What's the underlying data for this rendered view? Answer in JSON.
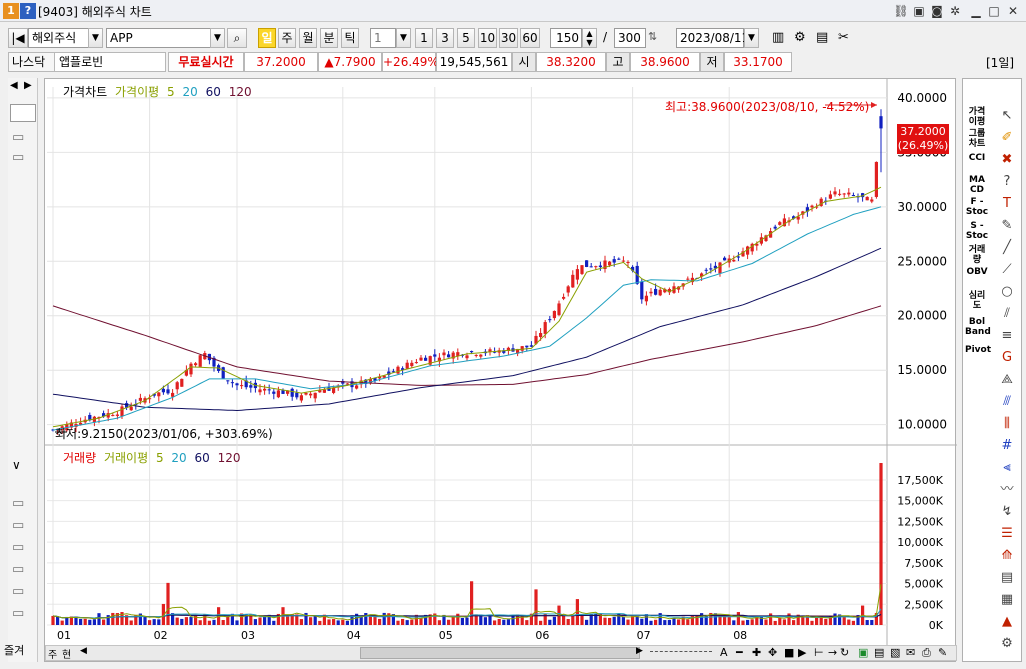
{
  "title": {
    "badge1": "1",
    "badge2": "?",
    "text": "[9403] 해외주식 차트"
  },
  "toolbar": {
    "market": "해외주식",
    "symbol": "APP",
    "periods": [
      "일",
      "주",
      "월",
      "분",
      "틱"
    ],
    "interval": "1",
    "minutes": [
      "1",
      "3",
      "5",
      "10",
      "30",
      "60"
    ],
    "count": "150",
    "slash": "/",
    "total": "300",
    "date": "2023/08/11"
  },
  "info": {
    "exchange": "나스닥",
    "name": "앱플로빈",
    "realtime": "무료실시간",
    "price": "37.2000",
    "change": "▲7.7900",
    "pct": "+26.49%",
    "volume": "19,545,561",
    "open_lbl": "시",
    "open": "38.3200",
    "high_lbl": "고",
    "high": "38.9600",
    "low_lbl": "저",
    "low": "33.1700",
    "period_tag": "[1일]"
  },
  "price_legend": {
    "name": "가격차트",
    "ma_name": "가격이평",
    "m5": "5",
    "m20": "20",
    "m60": "60",
    "m120": "120"
  },
  "volume_legend": {
    "name": "거래량",
    "ma_name": "거래이평",
    "m5": "5",
    "m20": "20",
    "m60": "60",
    "m120": "120"
  },
  "annotations": {
    "high": "최고:38.9600(2023/08/10, -4.52%)",
    "low": "최저:9.2150(2023/01/06, +303.69%)",
    "cur_price": "37.2000",
    "cur_pct": "(26.49%)"
  },
  "right_tools": [
    "가격 이평",
    "그룹 차트",
    "CCI",
    "MA CD",
    "F - Stoc",
    "S - Stoc",
    "거래 량",
    "OBV",
    "심리 도",
    "Bol Band",
    "Pivot"
  ],
  "bottom": {
    "tab1": "즐겨",
    "tab2": "주",
    "tab3": "현",
    "zoom_label": "A"
  },
  "colors": {
    "up": "#e02020",
    "down": "#1020c0",
    "ma5": "#8aa000",
    "ma20": "#20a0c0",
    "ma60": "#101060",
    "ma120": "#701030"
  },
  "chart_data": {
    "type": "candlestick",
    "months": [
      "01",
      "02",
      "03",
      "04",
      "05",
      "06",
      "07",
      "08"
    ],
    "price_axis": [
      "40.0000",
      "35.0000",
      "30.0000",
      "25.0000",
      "20.0000",
      "15.0000",
      "10.0000"
    ],
    "price_ylim": [
      8.5,
      41.0
    ],
    "volume_axis": [
      "17,500K",
      "15,000K",
      "12,500K",
      "10,000K",
      "7,500K",
      "5,000K",
      "2,500K",
      "0K"
    ],
    "volume_ylim": [
      0,
      19545561
    ],
    "close_path": [
      [
        0,
        9.5
      ],
      [
        6,
        10.4
      ],
      [
        14,
        11.2
      ],
      [
        22,
        12.8
      ],
      [
        26,
        13.2
      ],
      [
        30,
        15.6
      ],
      [
        33,
        16.5
      ],
      [
        36,
        14.8
      ],
      [
        40,
        13.6
      ],
      [
        46,
        13.2
      ],
      [
        50,
        13.0
      ],
      [
        54,
        12.5
      ],
      [
        58,
        13.2
      ],
      [
        64,
        13.6
      ],
      [
        70,
        14.0
      ],
      [
        76,
        15.3
      ],
      [
        80,
        16.1
      ],
      [
        88,
        16.6
      ],
      [
        96,
        16.7
      ],
      [
        104,
        17.2
      ],
      [
        110,
        21.2
      ],
      [
        114,
        24.5
      ],
      [
        120,
        24.8
      ],
      [
        125,
        25.0
      ],
      [
        128,
        21.6
      ],
      [
        132,
        22.4
      ],
      [
        138,
        23.2
      ],
      [
        146,
        24.8
      ],
      [
        152,
        26.5
      ],
      [
        158,
        28.5
      ],
      [
        162,
        29.1
      ],
      [
        166,
        30.3
      ],
      [
        170,
        31.2
      ],
      [
        174,
        31.0
      ],
      [
        178,
        30.5
      ],
      [
        180,
        37.2
      ]
    ],
    "ma5_path": [
      [
        0,
        9.8
      ],
      [
        10,
        10.6
      ],
      [
        20,
        12.2
      ],
      [
        30,
        15.3
      ],
      [
        36,
        15.2
      ],
      [
        44,
        13.6
      ],
      [
        54,
        12.9
      ],
      [
        64,
        13.6
      ],
      [
        76,
        15.0
      ],
      [
        90,
        16.5
      ],
      [
        104,
        17.0
      ],
      [
        110,
        19.5
      ],
      [
        116,
        24.0
      ],
      [
        124,
        24.9
      ],
      [
        128,
        23.4
      ],
      [
        134,
        22.2
      ],
      [
        142,
        23.8
      ],
      [
        150,
        25.8
      ],
      [
        160,
        28.7
      ],
      [
        168,
        30.5
      ],
      [
        176,
        31.0
      ],
      [
        180,
        31.8
      ]
    ],
    "ma20_path": [
      [
        0,
        9.5
      ],
      [
        14,
        10.6
      ],
      [
        26,
        12.5
      ],
      [
        34,
        14.2
      ],
      [
        44,
        14.2
      ],
      [
        56,
        13.3
      ],
      [
        68,
        13.8
      ],
      [
        82,
        15.4
      ],
      [
        98,
        16.3
      ],
      [
        108,
        17.2
      ],
      [
        116,
        19.8
      ],
      [
        124,
        22.8
      ],
      [
        130,
        23.3
      ],
      [
        140,
        23.2
      ],
      [
        152,
        24.8
      ],
      [
        164,
        27.5
      ],
      [
        174,
        29.3
      ],
      [
        180,
        30.0
      ]
    ],
    "ma60_path": [
      [
        0,
        12.8
      ],
      [
        20,
        11.6
      ],
      [
        40,
        11.3
      ],
      [
        60,
        11.9
      ],
      [
        80,
        13.4
      ],
      [
        100,
        14.5
      ],
      [
        116,
        16.2
      ],
      [
        132,
        19.0
      ],
      [
        150,
        21.0
      ],
      [
        166,
        23.6
      ],
      [
        180,
        26.2
      ]
    ],
    "ma120_path": [
      [
        0,
        20.9
      ],
      [
        20,
        18.2
      ],
      [
        40,
        15.3
      ],
      [
        60,
        14.0
      ],
      [
        80,
        13.6
      ],
      [
        100,
        13.7
      ],
      [
        116,
        14.6
      ],
      [
        130,
        16.0
      ],
      [
        150,
        17.6
      ],
      [
        166,
        19.1
      ],
      [
        180,
        20.9
      ]
    ],
    "vol_spikes": [
      [
        15,
        0.08
      ],
      [
        24,
        0.13
      ],
      [
        25,
        0.26
      ],
      [
        36,
        0.11
      ],
      [
        50,
        0.11
      ],
      [
        91,
        0.27
      ],
      [
        105,
        0.22
      ],
      [
        110,
        0.12
      ],
      [
        114,
        0.16
      ],
      [
        149,
        0.08
      ],
      [
        176,
        0.12
      ],
      [
        180,
        1.0
      ]
    ]
  }
}
